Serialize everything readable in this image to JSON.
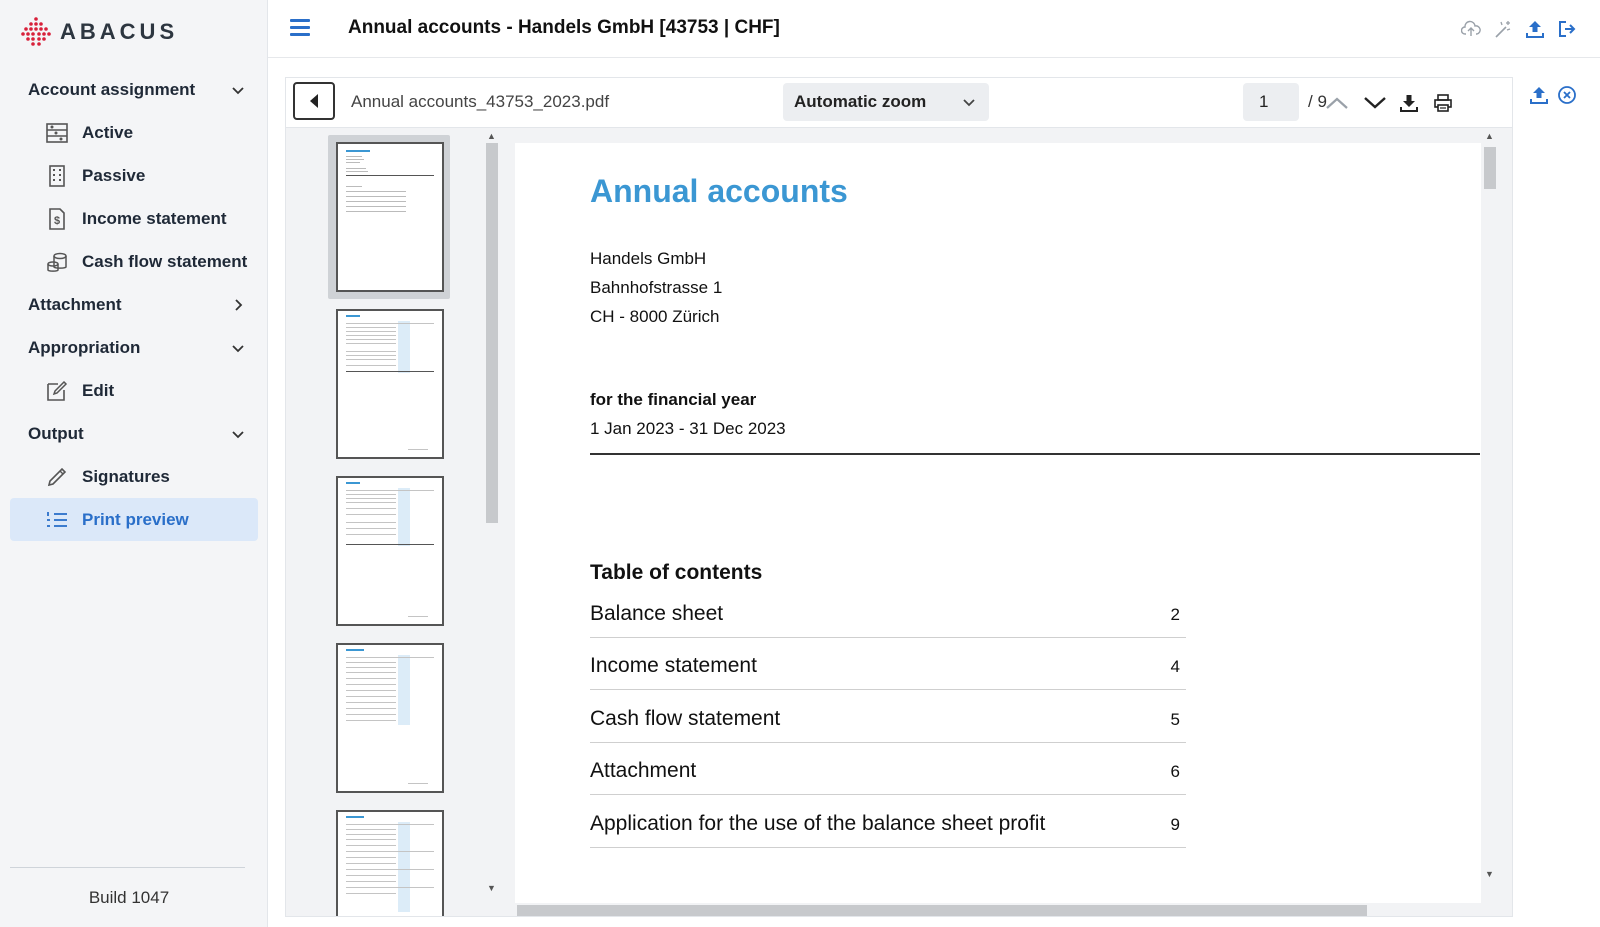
{
  "app": {
    "logo_text": "ABACUS",
    "title": "Annual accounts - Handels GmbH [43753 | CHF]",
    "build": "Build 1047"
  },
  "sidebar": {
    "groups": [
      {
        "label": "Account assignment",
        "expanded": true
      },
      {
        "label": "Attachment",
        "expanded": false
      },
      {
        "label": "Appropriation",
        "expanded": true
      },
      {
        "label": "Output",
        "expanded": true
      }
    ],
    "items": [
      {
        "label": "Active",
        "icon": "abacus-icon"
      },
      {
        "label": "Passive",
        "icon": "building-icon"
      },
      {
        "label": "Income statement",
        "icon": "dollar-document-icon"
      },
      {
        "label": "Cash flow statement",
        "icon": "coins-icon"
      },
      {
        "label": "Edit",
        "icon": "edit-icon"
      },
      {
        "label": "Signatures",
        "icon": "pen-icon"
      },
      {
        "label": "Print preview",
        "icon": "list-icon",
        "active": true
      }
    ]
  },
  "viewer": {
    "filename": "Annual accounts_43753_2023.pdf",
    "zoom": "Automatic zoom",
    "page_current": "1",
    "page_total": "/ 9"
  },
  "document": {
    "title": "Annual accounts",
    "company": "Handels GmbH",
    "street": "Bahnhofstrasse 1",
    "city": "CH - 8000 Zürich",
    "fy_label": "for the financial year",
    "fy_range": "1 Jan 2023 - 31 Dec 2023",
    "toc_title": "Table of contents",
    "toc": [
      {
        "title": "Balance sheet",
        "page": "2"
      },
      {
        "title": "Income statement",
        "page": "4"
      },
      {
        "title": "Cash flow statement",
        "page": "5"
      },
      {
        "title": "Attachment",
        "page": "6"
      },
      {
        "title": "Application for the use of the balance sheet profit",
        "page": "9"
      }
    ]
  },
  "colors": {
    "accent": "#2a6fc9",
    "doc_title": "#3b97d3",
    "active_bg": "#dbe8f9",
    "logo_red": "#d8203a"
  }
}
